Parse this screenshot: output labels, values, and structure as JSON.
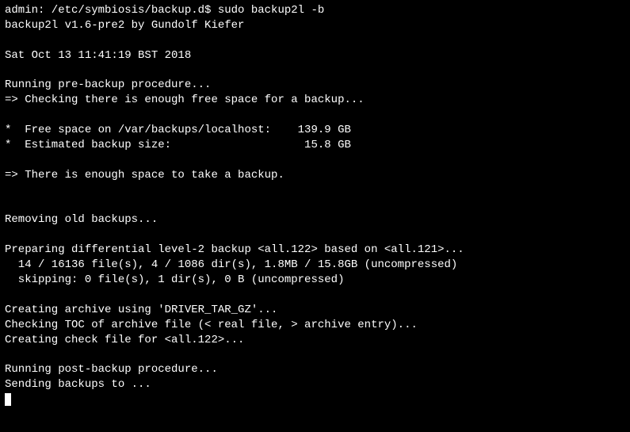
{
  "prompt": "admin: /etc/symbiosis/backup.d$ sudo backup2l -b",
  "version": "backup2l v1.6-pre2 by Gundolf Kiefer",
  "timestamp": "Sat Oct 13 11:41:19 BST 2018",
  "pre_proc": "Running pre-backup procedure...",
  "check_space": "=> Checking there is enough free space for a backup...",
  "free_space": "*  Free space on /var/backups/localhost:    139.9 GB",
  "est_size": "*  Estimated backup size:                    15.8 GB",
  "enough": "=> There is enough space to take a backup.",
  "removing": "Removing old backups...",
  "preparing": "Preparing differential level-2 backup <all.122> based on <all.121>...",
  "stats1": "  14 / 16136 file(s), 4 / 1086 dir(s), 1.8MB / 15.8GB (uncompressed)",
  "stats2": "  skipping: 0 file(s), 1 dir(s), 0 B (uncompressed)",
  "creating_archive": "Creating archive using 'DRIVER_TAR_GZ'...",
  "checking_toc": "Checking TOC of archive file (< real file, > archive entry)...",
  "creating_check": "Creating check file for <all.122>...",
  "post_proc": "Running post-backup procedure...",
  "sending": "Sending backups to ..."
}
